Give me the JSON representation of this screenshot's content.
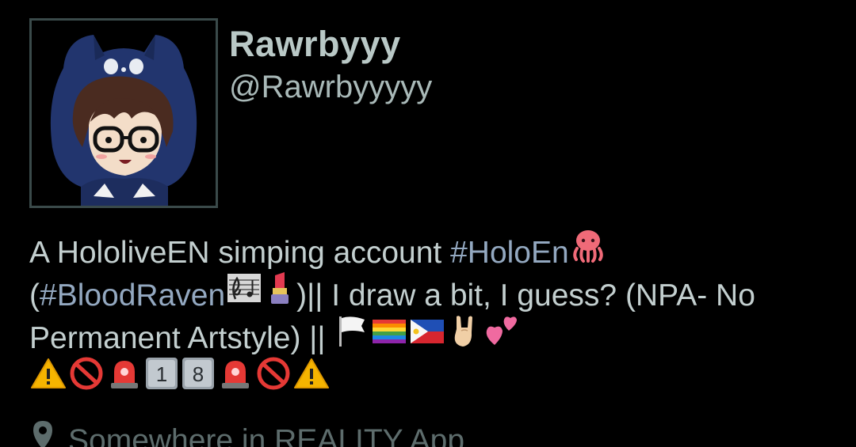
{
  "profile": {
    "display_name": "Rawrbyyy",
    "handle": "@Rawrbyyyyy",
    "bio": {
      "line1_text": "A HololiveEN simping account ",
      "line1_hashtag": "#HoloEn",
      "line2_open": "(",
      "line2_hashtag": "#BloodRaven",
      "line2_text": ")|| I draw a bit, I guess? (NPA- No",
      "line3_text": "Permanent Artstyle) || ",
      "badge_1": "1",
      "badge_8": "8"
    },
    "location": "Somewhere in REALITY App"
  },
  "icons": {
    "avatar": "avatar-image",
    "line1": [
      "octopus-icon"
    ],
    "line2": [
      "musical-score-icon",
      "lipstick-icon"
    ],
    "line3": [
      "white-flag-icon",
      "rainbow-flag-icon",
      "philippines-flag-icon",
      "sign-of-horns-icon",
      "two-hearts-icon"
    ],
    "line4": [
      "warning-icon",
      "no-entry-icon",
      "police-light-icon",
      "keycap-1-icon",
      "keycap-8-icon",
      "police-light-icon",
      "no-entry-icon",
      "warning-icon"
    ],
    "location": "location-pin-icon"
  },
  "colors": {
    "background": "#000000",
    "name": "#b9c8c6",
    "text": "#c3cfcf",
    "hashtag": "#93a8c0",
    "location": "#5d6c6c",
    "avatar_border": "#3a4a4a"
  }
}
